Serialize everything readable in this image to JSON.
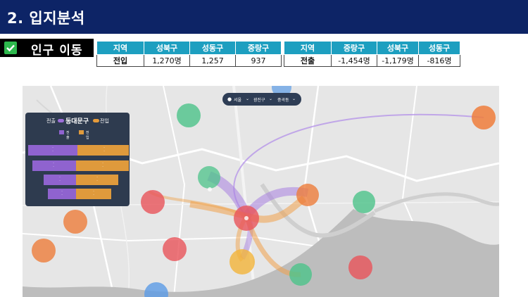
{
  "header": {
    "title": "2. 입지분석"
  },
  "section": {
    "label": "인구 이동"
  },
  "inflow_table": {
    "headers": [
      "지역",
      "성북구",
      "성동구",
      "중랑구"
    ],
    "row_label": "전입",
    "values": [
      "1,270명",
      "1,257",
      "937"
    ]
  },
  "outflow_table": {
    "headers": [
      "지역",
      "중랑구",
      "성북구",
      "성동구"
    ],
    "row_label": "전출",
    "values": [
      "-1,454명",
      "-1,179명",
      "-816명"
    ]
  },
  "map": {
    "controls": [
      "서울",
      "광진구",
      "중곡동"
    ],
    "panel": {
      "out_label": "전출",
      "center": "동대문구",
      "in_label": "전입",
      "legend_out": "전출",
      "legend_in": "전입"
    }
  },
  "colors": {
    "header_bg": "#0d2466",
    "table_header": "#1d9fc0",
    "check_green": "#2db84d",
    "outflow_purple": "#9b6ed8",
    "inflow_orange": "#e69b3a"
  }
}
